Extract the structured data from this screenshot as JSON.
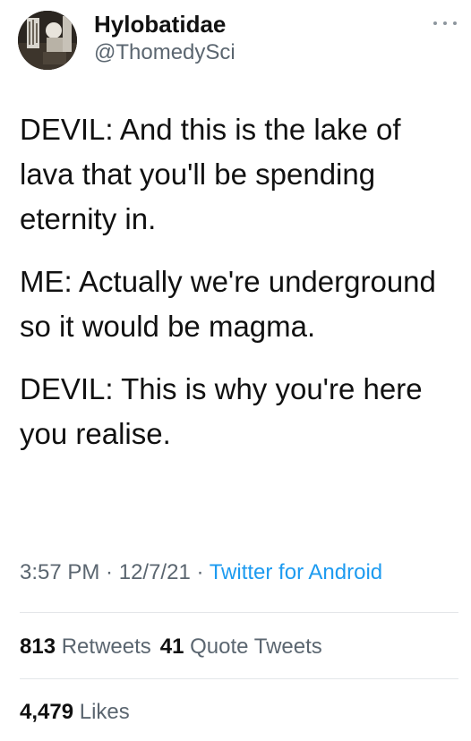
{
  "tweet": {
    "author": {
      "display_name": "Hylobatidae",
      "handle": "@ThomedySci"
    },
    "more_icon": "more-horizontal-icon",
    "paragraphs": [
      "DEVIL: And this is the lake of lava that you'll be spending eternity in.",
      "ME: Actually we're underground so it would be magma.",
      "DEVIL: This is why you're here you realise."
    ],
    "meta": {
      "time": "3:57 PM",
      "separator": " · ",
      "date": "12/7/21",
      "source": "Twitter for Android"
    },
    "stats": {
      "retweets_count": "813",
      "retweets_label": "Retweets",
      "quote_tweets_count": "41",
      "quote_tweets_label": "Quote Tweets",
      "likes_count": "4,479",
      "likes_label": "Likes"
    }
  },
  "colors": {
    "text": "#111111",
    "secondary": "#5b6670",
    "link": "#1d9bf0",
    "divider": "#e3e6e9"
  }
}
